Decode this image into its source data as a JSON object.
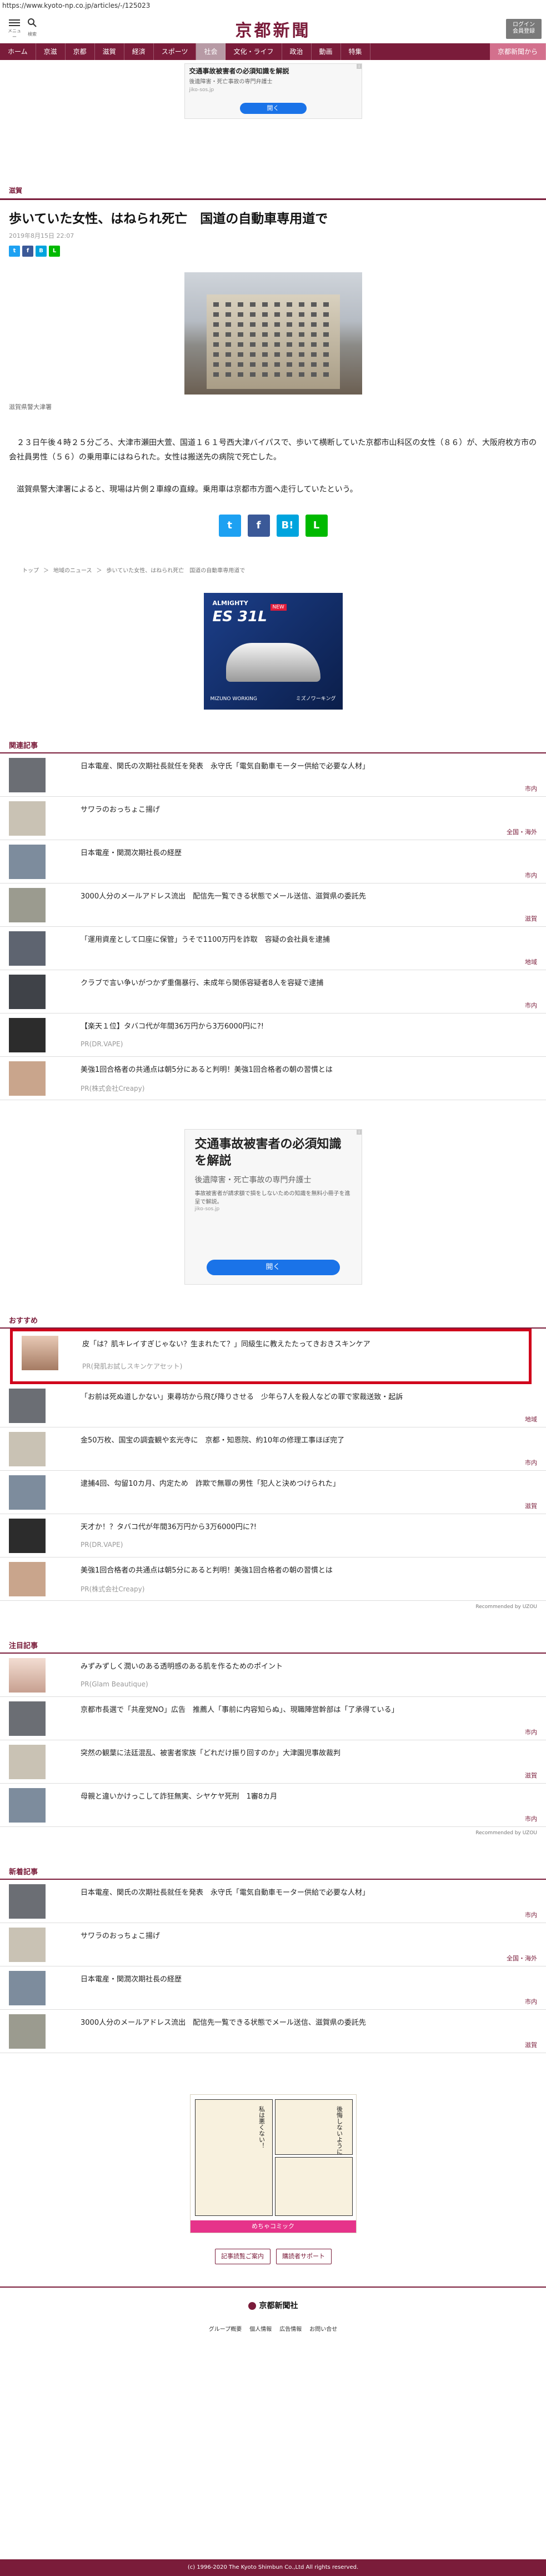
{
  "url": "https://www.kyoto-np.co.jp/articles/-/125023",
  "header": {
    "menu_caption": "メニュー",
    "search_caption": "検索",
    "logo": "京都新聞",
    "login_line1": "ログイン",
    "login_line2": "会員登録"
  },
  "nav": [
    {
      "label": "ホーム",
      "active": false
    },
    {
      "label": "京滋",
      "active": false
    },
    {
      "label": "京都",
      "active": false
    },
    {
      "label": "滋賀",
      "active": false
    },
    {
      "label": "経済",
      "active": false
    },
    {
      "label": "スポーツ",
      "active": false
    },
    {
      "label": "社会",
      "active": true
    },
    {
      "label": "文化・ライフ",
      "active": false
    },
    {
      "label": "政治",
      "active": false
    },
    {
      "label": "動画",
      "active": false
    },
    {
      "label": "特集",
      "active": false
    },
    {
      "label": "京都新聞から",
      "active": false
    }
  ],
  "top_ad": {
    "title": "交通事故被害者の必須知識を解説",
    "sub": "後遺障害・死亡事故の専門弁護士",
    "url": "jiko-sos.jp",
    "button": "開く"
  },
  "article": {
    "category": "滋賀",
    "headline": "歩いていた女性、はねられ死亡　国道の自動車専用道で",
    "date": "2019年8月15日 22:07",
    "photo_caption": "滋賀県警大津署",
    "paragraphs": [
      "２３日午後４時２５分ごろ、大津市瀬田大萱、国道１６１号西大津バイパスで、歩いて横断していた京都市山科区の女性（８６）が、大阪府枚方市の会社員男性（５６）の乗用車にはねられた。女性は搬送先の病院で死亡した。",
      "滋賀県警大津署によると、現場は片側２車線の直線。乗用車は京都市方面へ走行していたという。"
    ]
  },
  "breadcrumb": [
    "トップ",
    "＞",
    "地域のニュース",
    "＞",
    "歩いていた女性、はねられ死亡　国道の自動車専用道で"
  ],
  "shoe_ad": {
    "brand": "ALMIGHTY",
    "badge": "NEW",
    "name": "ES 31L",
    "foot_left": "MIZUNO WORKING",
    "foot_right": "ミズノワーキング"
  },
  "related": {
    "title": "関連記事",
    "items": [
      {
        "title": "日本電産、関氏の次期社長就任を発表　永守氏「電気自動車モーター供給で必要な人材」",
        "cat": "市内"
      },
      {
        "title": "サワラのおっちょこ揚げ",
        "cat": "全国・海外"
      },
      {
        "title": "日本電産・関潤次期社長の経歴",
        "cat": "市内"
      },
      {
        "title": "3000人分のメールアドレス流出　配信先一覧できる状態でメール送信、滋賀県の委託先",
        "cat": "滋賀"
      },
      {
        "title": "「運用資産として口座に保管」うそで1100万円を詐取　容疑の会社員を逮捕",
        "cat": "地域"
      },
      {
        "title": "クラブで言い争いがつかず重傷暴行、未成年ら関係容疑者8人を容疑で逮捕",
        "cat": "市内"
      }
    ],
    "pr_items": [
      {
        "title": "【楽天１位】タバコ代が年間36万円から3万6000円に?!",
        "pr": "PR(DR.VAPE)"
      },
      {
        "title": "美強1回合格者の共通点は朝5分にあると判明！美強1回合格者の朝の習慣とは",
        "pr": "PR(株式会社Creapy)"
      }
    ]
  },
  "mid_ad": {
    "title": "交通事故被害者の必須知識を解説",
    "sub": "後遺障害・死亡事故の専門弁護士",
    "desc": "事故被害者が請求額で損をしないための知識を無料小冊子を進呈で解説。",
    "url": "jiko-sos.jp",
    "button": "開く"
  },
  "recommend": {
    "title": "おすすめ",
    "highlighted": {
      "title": "皮「は？肌キレイすぎじゃない？生まれたて？」同級生に教えたたってきおきスキンケア",
      "pr": "PR(発肌お試しスキンケアセット)"
    },
    "items": [
      {
        "title": "「お前は死ぬ道しかない」東尋坊から飛び降りさせる　少年ら7人を殺人などの罪で家裁送致・起訴",
        "cat": "地域"
      },
      {
        "title": "金50万枚、国宝の調査観や玄光寺に　京都・知恩院、約10年の修理工事ほぼ完了",
        "cat": "市内"
      },
      {
        "title": "逮捕4回、勾留10カ月、内定ため　詐欺で無罪の男性「犯人と決めつけられた」",
        "cat": "滋賀"
      }
    ],
    "pr_items": [
      {
        "title": "天才か！？タバコ代が年間36万円から3万6000円に?!",
        "pr": "PR(DR.VAPE)"
      },
      {
        "title": "美強1回合格者の共通点は朝5分にあると判明！美強1回合格者の朝の習慣とは",
        "pr": "PR(株式会社Creapy)"
      }
    ],
    "by": "Recommended by UZOU"
  },
  "attention": {
    "title": "注目記事",
    "pr_item": {
      "title": "みずみずしく潤いのある透明感のある肌を作るためのポイント",
      "pr": "PR(Glam Beautique)"
    },
    "items": [
      {
        "title": "京都市長選で「共産党NO」広告　推薦人「事前に内容知らぬ」、現職陣営幹部は「了承得ている」",
        "cat": "市内"
      },
      {
        "title": "突然の観葉に法廷混乱、被害者家族「どれだけ振り回すのか」大津園児事故裁判",
        "cat": "滋賀"
      },
      {
        "title": "母親と違いかけっこして詐狂無実、シヤケヤ死刑　1審8カ月",
        "cat": "市内"
      }
    ],
    "by": "Recommended by UZOU"
  },
  "latest": {
    "title": "新着記事",
    "items": [
      {
        "title": "日本電産、関氏の次期社長就任を発表　永守氏「電気自動車モーター供給で必要な人材」",
        "cat": "市内"
      },
      {
        "title": "サワラのおっちょこ揚げ",
        "cat": "全国・海外"
      },
      {
        "title": "日本電産・関潤次期社長の経歴",
        "cat": "市内"
      },
      {
        "title": "3000人分のメールアドレス流出　配信先一覧できる状態でメール送信、滋賀県の委託先",
        "cat": "滋賀"
      }
    ]
  },
  "manga_ad": {
    "text1": "私は悪くない！",
    "text2": "後悔しないように",
    "footer": "めちゃコミック"
  },
  "footer": {
    "btn1": "記事読覧ご案内",
    "btn2": "購読者サポート",
    "logo": "京都新聞社",
    "links": [
      "グループ概要",
      "個人情報",
      "広告情報",
      "お問い合せ"
    ],
    "copyright": "(c) 1996-2020 The Kyoto Shimbun Co.,Ltd All rights reserved."
  }
}
